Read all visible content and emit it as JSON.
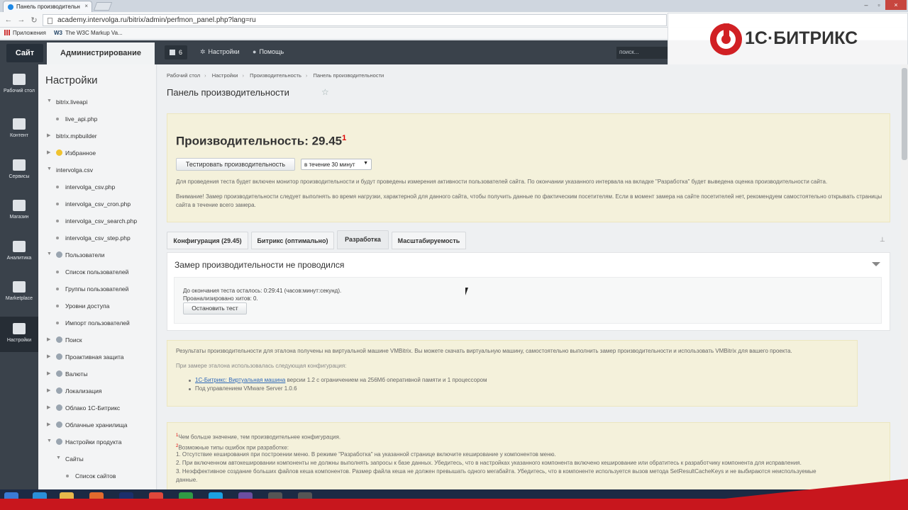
{
  "browser": {
    "tab_title": "Панель производительн",
    "url": "academy.intervolga.ru/bitrix/admin/perfmon_panel.php?lang=ru",
    "bookmarks": [
      "Приложения",
      "The W3C Markup Va..."
    ]
  },
  "logo": {
    "text": "1С·БИТРИКС"
  },
  "topbar": {
    "site_label": "Сайт",
    "admin_label": "Администрирование",
    "notif_count": "6",
    "settings_label": "Настройки",
    "help_label": "Помощь",
    "search_placeholder": "поиск..."
  },
  "rail": {
    "items": [
      {
        "label": "Рабочий стол",
        "icon": "home-icon"
      },
      {
        "label": "Контент",
        "icon": "document-icon"
      },
      {
        "label": "Сервисы",
        "icon": "layers-icon"
      },
      {
        "label": "Магазин",
        "icon": "basket-icon"
      },
      {
        "label": "Аналитика",
        "icon": "bar-chart-icon"
      },
      {
        "label": "Marketplace",
        "icon": "cloud-download-icon"
      },
      {
        "label": "Настройки",
        "icon": "gear-icon"
      }
    ]
  },
  "nav": {
    "title": "Настройки",
    "items": [
      {
        "label": "bitrix.liveapi",
        "type": "expanded"
      },
      {
        "label": "live_api.php",
        "type": "child"
      },
      {
        "label": "bitrix.mpbuilder",
        "type": "collapsed"
      },
      {
        "label": "Избранное",
        "type": "collapsed",
        "icon": "star-icon"
      },
      {
        "label": "intervolga.csv",
        "type": "expanded"
      },
      {
        "label": "intervolga_csv.php",
        "type": "child"
      },
      {
        "label": "intervolga_csv_cron.php",
        "type": "child"
      },
      {
        "label": "intervolga_csv_search.php",
        "type": "child"
      },
      {
        "label": "intervolga_csv_step.php",
        "type": "child"
      },
      {
        "label": "Пользователи",
        "type": "expanded",
        "icon": "user-icon"
      },
      {
        "label": "Список пользователей",
        "type": "child"
      },
      {
        "label": "Группы пользователей",
        "type": "child"
      },
      {
        "label": "Уровни доступа",
        "type": "child"
      },
      {
        "label": "Импорт пользователей",
        "type": "child"
      },
      {
        "label": "Поиск",
        "type": "collapsed",
        "icon": "search-icon"
      },
      {
        "label": "Проактивная защита",
        "type": "collapsed",
        "icon": "shield-icon"
      },
      {
        "label": "Валюты",
        "type": "collapsed",
        "icon": "coin-icon"
      },
      {
        "label": "Локализация",
        "type": "collapsed",
        "icon": "globe-icon"
      },
      {
        "label": "Облако 1С-Битрикс",
        "type": "collapsed",
        "icon": "cloud-icon"
      },
      {
        "label": "Облачные хранилища",
        "type": "collapsed",
        "icon": "storage-icon"
      },
      {
        "label": "Настройки продукта",
        "type": "expanded",
        "icon": "gear-icon"
      },
      {
        "label": "Сайты",
        "type": "subexpanded"
      },
      {
        "label": "Список сайтов",
        "type": "subchild"
      }
    ]
  },
  "breadcrumb": [
    "Рабочий стол",
    "Настройки",
    "Производительность",
    "Панель производительности"
  ],
  "page": {
    "title": "Панель производительности"
  },
  "perf": {
    "title": "Производительность: 29.45",
    "sup": "1",
    "test_button": "Тестировать производительность",
    "duration_select": "в течение 30 минут",
    "desc1": "Для проведения теста будет включен монитор производительности и будут проведены измерения активности пользователей сайта. По окончании указанного интервала на вкладке \"Разработка\" будет выведена оценка производительности сайта.",
    "desc2": "Внимание! Замер производительности следует выполнять во время нагрузки, характерной для данного сайта, чтобы получить данные по фактическим посетителям. Если в момент замера на сайте посетителей нет, рекомендуем самостоятельно открывать страницы сайта в течение всего замера."
  },
  "tabs": [
    "Конфигурация (29.45)",
    "Битрикс (оптимально)",
    "Разработка",
    "Масштабируемость"
  ],
  "measure": {
    "title": "Замер производительности не проводился",
    "remaining": "До окончания теста осталось: 0:29:41 (часов:минут:секунд).",
    "hits": "Проанализировано хитов: 0.",
    "stop_button": "Остановить тест"
  },
  "reference": {
    "line1": "Результаты производительности для эталона получены на виртуальной машине VMBitrix. Вы можете скачать виртуальную машину, самостоятельно выполнить замер производительности и использовать VMBitrix для вашего проекта.",
    "line2": "При замере эталона использовалась следующая конфигурация:",
    "bullet1_link": "1С-Битрикс: Виртуальная машина",
    "bullet1_rest": " версии 1.2 с ограничением на 256Мб оперативной памяти и 1 процессором",
    "bullet2": "Под управлением VMware Server 1.0.6"
  },
  "notes": {
    "n1": "Чем больше значение, тем производительнее конфигурация.",
    "n2": "Возможные типы ошибок при разработке:",
    "n3": "1. Отсутствие кеширования при построении меню. В режиме \"Разработка\" на указанной странице включите кеширование у компонентов меню.",
    "n4": "2. При включенном автокешировании компоненты не должны выполнять запросы к базе данных. Убедитесь, что в настройках указанного компонента включено кеширование или обратитесь к разработчику компонента для исправления.",
    "n5": "3. Неэффективное создание больших файлов кеша компонентов. Размер файла кеша не должен превышать одного мегабайта. Убедитесь, что в компоненте используется вызов метода SetResultCacheKeys и не выбираются неиспользуемые",
    "n6": "данные."
  },
  "colors": {
    "brand_red": "#d12024",
    "sidebar_dark": "#3a424b",
    "note_yellow": "#f4f1db"
  }
}
